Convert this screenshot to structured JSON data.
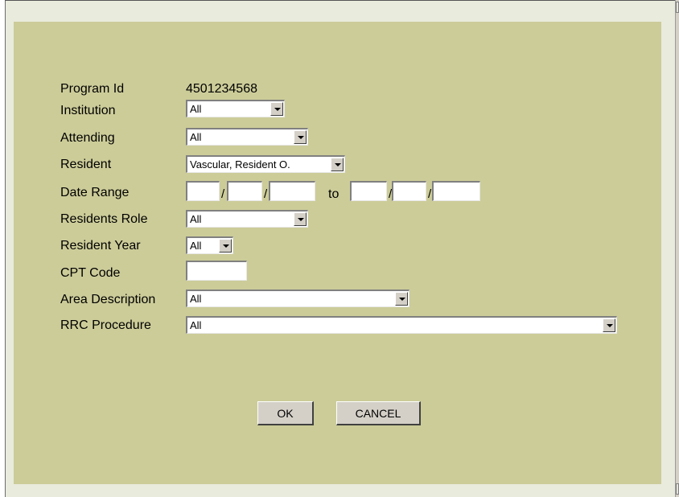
{
  "form": {
    "program_id": {
      "label": "Program Id",
      "value": "4501234568"
    },
    "institution": {
      "label": "Institution",
      "selected": "All"
    },
    "attending": {
      "label": "Attending",
      "selected": "All"
    },
    "resident": {
      "label": "Resident",
      "selected": "Vascular, Resident O."
    },
    "date_range": {
      "label": "Date Range",
      "separator": "/",
      "to": "to",
      "from_month": "",
      "from_day": "",
      "from_year": "",
      "to_month": "",
      "to_day": "",
      "to_year": ""
    },
    "residents_role": {
      "label": "Residents Role",
      "selected": "All"
    },
    "resident_year": {
      "label": "Resident Year",
      "selected": "All"
    },
    "cpt_code": {
      "label": "CPT Code",
      "value": ""
    },
    "area_description": {
      "label": "Area Description",
      "selected": "All"
    },
    "rrc_procedure": {
      "label": "RRC Procedure",
      "selected": "All"
    }
  },
  "buttons": {
    "ok": "OK",
    "cancel": "CANCEL"
  },
  "colors": {
    "panel": "#cccc99",
    "page": "#e9ebdc",
    "button": "#d4d0c8"
  }
}
